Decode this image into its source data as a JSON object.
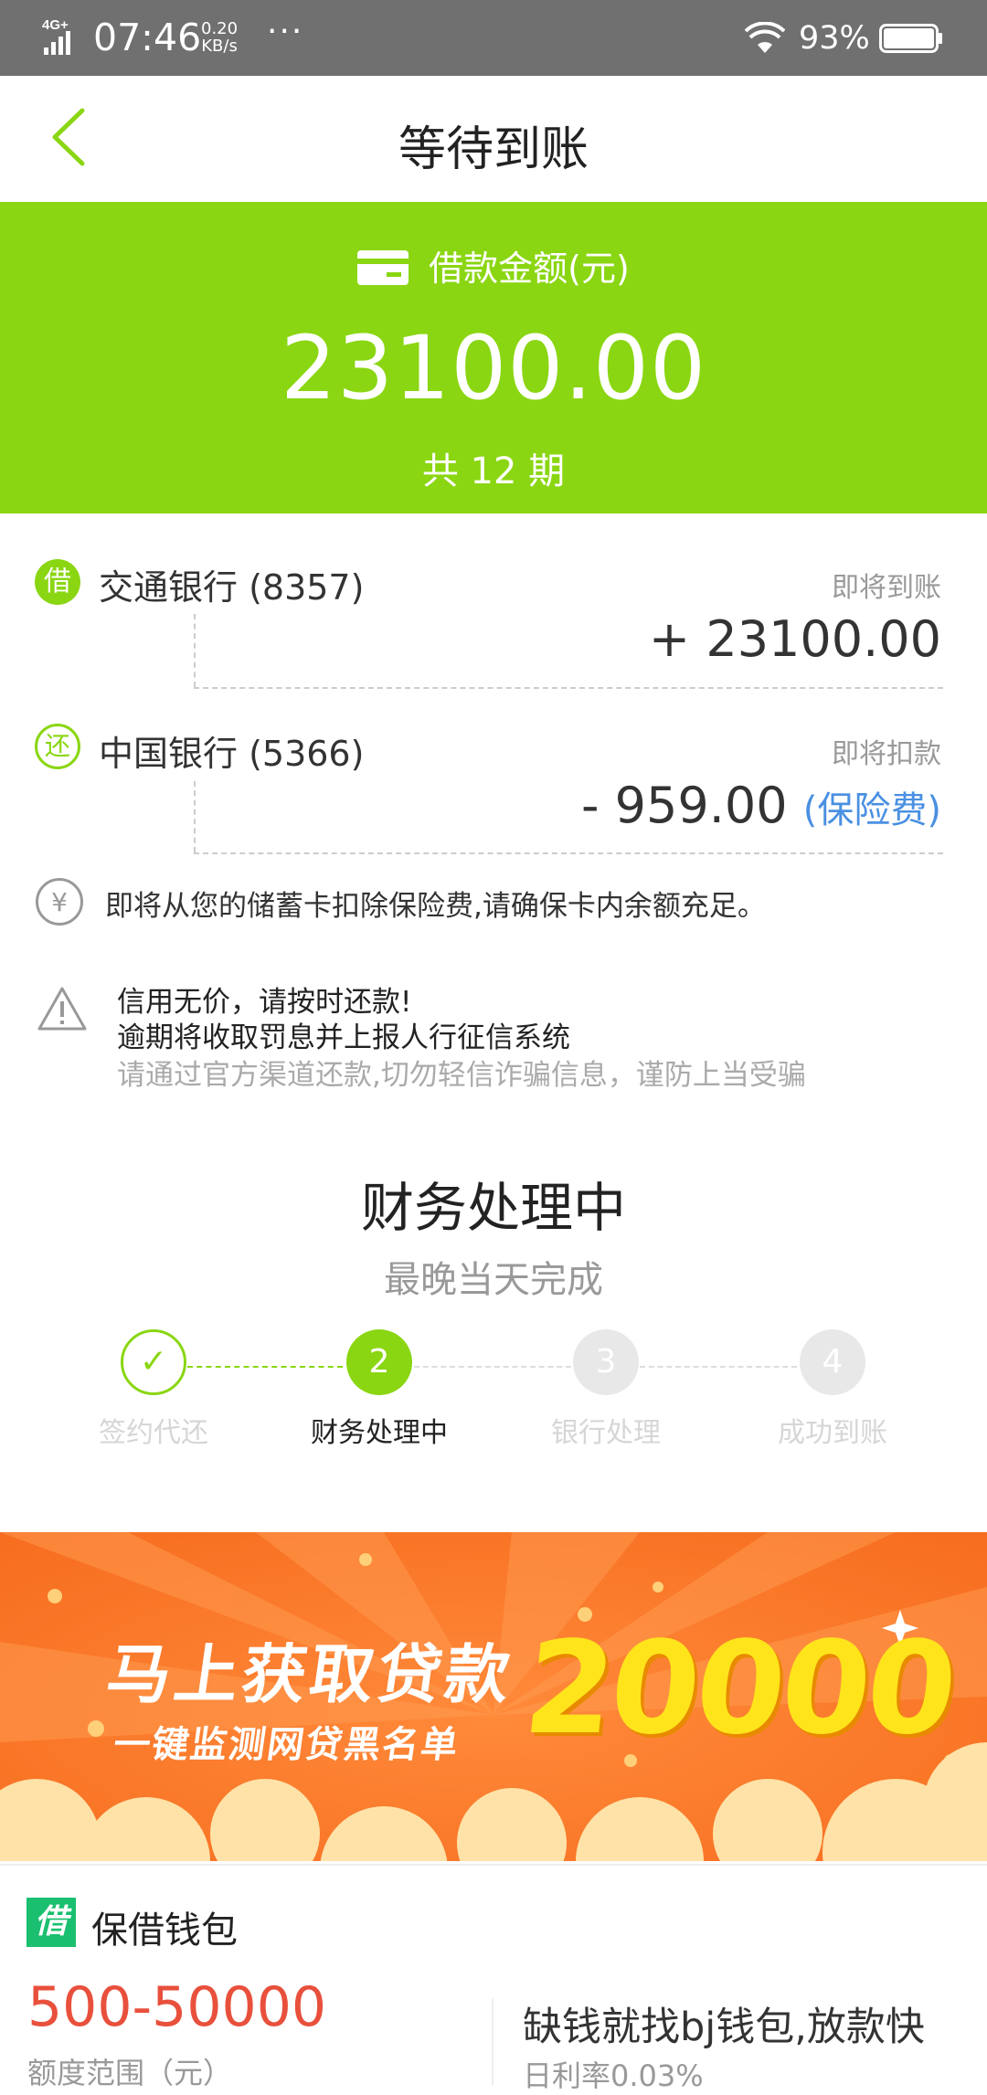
{
  "status_bar": {
    "network": "4G+",
    "time": "07:46",
    "speed_value": "0.20",
    "speed_unit": "KB/s",
    "more": "···",
    "battery_percent": "93%"
  },
  "header": {
    "title": "等待到账"
  },
  "hero": {
    "label": "借款金额(元)",
    "amount": "23100.00",
    "periods": "共 12 期",
    "bg_color": "#8ad612"
  },
  "transactions": [
    {
      "icon": "借",
      "bank": "交通银行 (8357)",
      "status": "即将到账",
      "amount": "+ 23100.00"
    },
    {
      "icon": "还",
      "bank": "中国银行 (5366)",
      "status": "即将扣款",
      "amount": "- 959.00",
      "note": "(保险费)"
    }
  ],
  "notice": {
    "text": "即将从您的储蓄卡扣除保险费,请确保卡内余额充足。"
  },
  "warning": {
    "line1": "信用无价，请按时还款!",
    "line2": "逾期将收取罚息并上报人行征信系统",
    "line3": "请通过官方渠道还款,切勿轻信诈骗信息，谨防上当受骗"
  },
  "processing": {
    "title": "财务处理中",
    "subtitle": "最晚当天完成",
    "steps": [
      {
        "number": "✓",
        "label": "签约代还",
        "state": "done"
      },
      {
        "number": "2",
        "label": "财务处理中",
        "state": "active"
      },
      {
        "number": "3",
        "label": "银行处理",
        "state": "pending"
      },
      {
        "number": "4",
        "label": "成功到账",
        "state": "pending"
      }
    ]
  },
  "banner": {
    "headline": "马上获取贷款",
    "subline": "一键监测网贷黑名单",
    "number": "20000"
  },
  "product": {
    "logo": "借",
    "name": "保借钱包",
    "range": "500-50000",
    "range_label": "额度范围（元）",
    "slogan": "缺钱就找bj钱包,放款快",
    "rate": "日利率0.03%"
  }
}
